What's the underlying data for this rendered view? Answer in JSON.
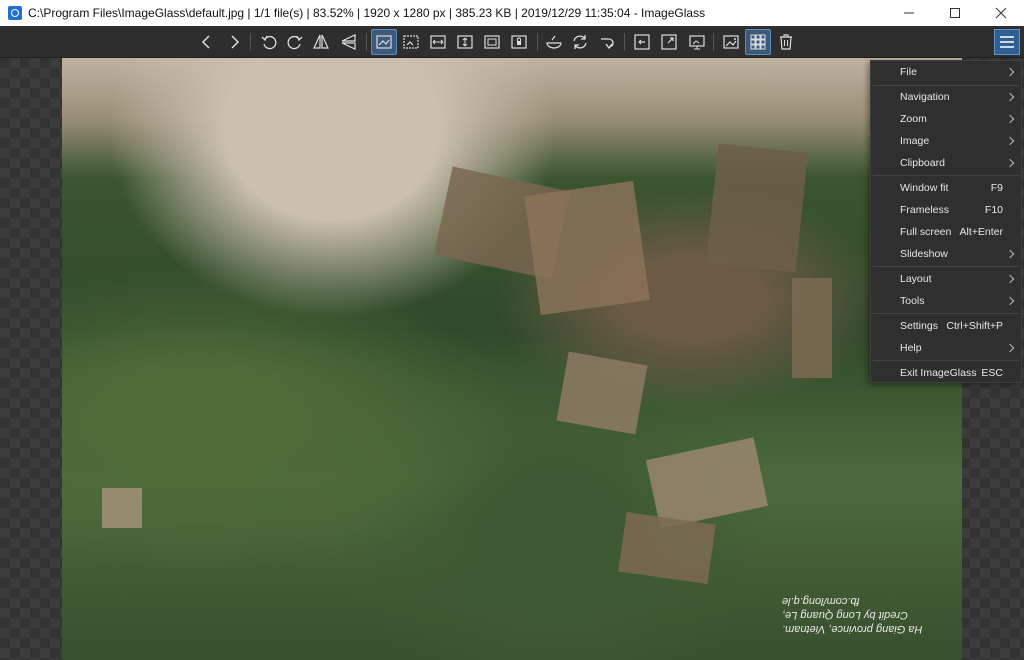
{
  "window": {
    "title": "C:\\Program Files\\ImageGlass\\default.jpg  |  1/1 file(s)  |  83.52%  |  1920 x 1280 px  |  385.23 KB  |  2019/12/29 11:35:04  - ImageGlass"
  },
  "photo": {
    "caption_line1": "Ha Giang province, Vietnam.",
    "caption_line2": "Credit by Long Quang Le, fb.com/long.q.le"
  },
  "menu": {
    "file": "File",
    "navigation": "Navigation",
    "zoom": "Zoom",
    "image": "Image",
    "clipboard": "Clipboard",
    "window_fit": "Window fit",
    "window_fit_key": "F9",
    "frameless": "Frameless",
    "frameless_key": "F10",
    "full_screen": "Full screen",
    "full_screen_key": "Alt+Enter",
    "slideshow": "Slideshow",
    "layout": "Layout",
    "tools": "Tools",
    "settings": "Settings",
    "settings_key": "Ctrl+Shift+P",
    "help": "Help",
    "exit": "Exit ImageGlass",
    "exit_key": "ESC"
  },
  "colors": {
    "accent": "#2f5f93",
    "toolbar_bg": "#2e2e2e",
    "menu_bg": "#2f2f2f"
  }
}
